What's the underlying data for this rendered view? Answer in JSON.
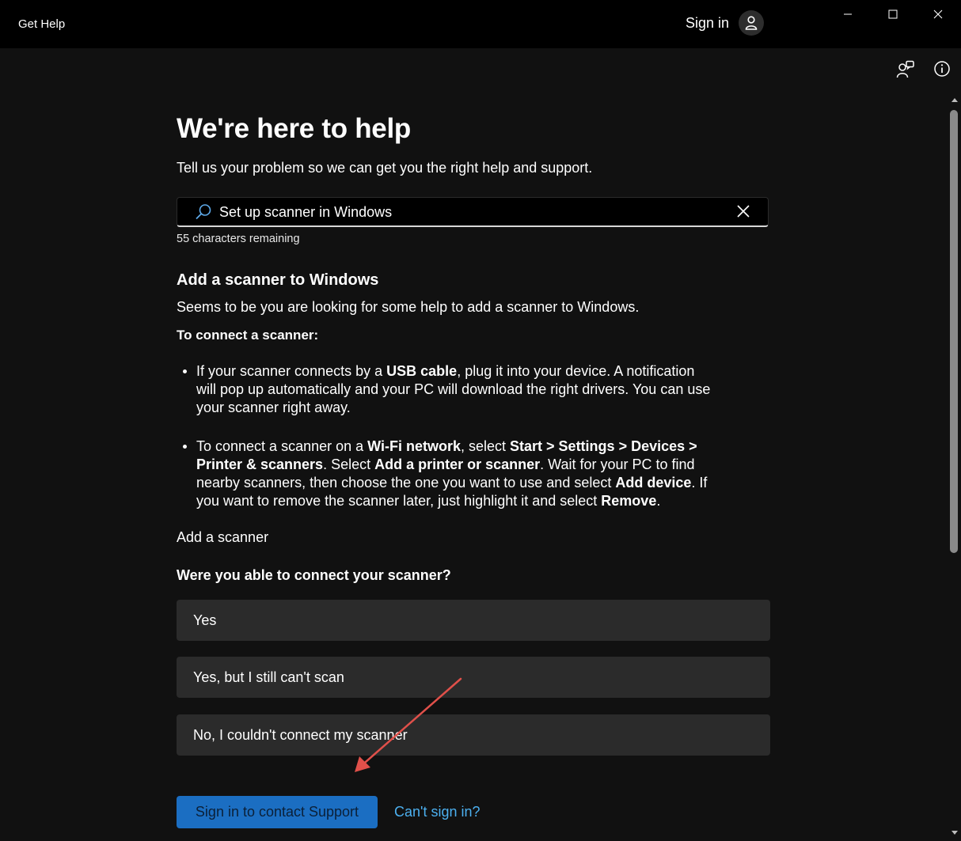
{
  "window": {
    "title": "Get Help",
    "sign_in_label": "Sign in"
  },
  "page": {
    "heading": "We're here to help",
    "subtitle": "Tell us your problem so we can get you the right help and support."
  },
  "search": {
    "value": "Set up scanner in Windows",
    "chars_remaining": "55 characters remaining"
  },
  "article": {
    "title": "Add a scanner to Windows",
    "intro": "Seems to be you are looking for some help to add a scanner to Windows.",
    "connect_heading": "To connect a scanner:",
    "bullet1": {
      "t1": "If your scanner connects by a ",
      "b1": "USB cable",
      "t2": ", plug it into your device. A notification will pop up automatically and your PC will download the right drivers. You can use your scanner right away."
    },
    "bullet2": {
      "t1": "To connect a scanner on a ",
      "b1": "Wi-Fi network",
      "t2": ", select ",
      "b2": "Start",
      "t3": " > ",
      "b3": "Settings",
      "t4": " > ",
      "b4": "Devices",
      "t5": " > ",
      "b5": "Printer & scanners",
      "t6": ". Select ",
      "b6": "Add a printer or scanner",
      "t7": ". Wait for your PC to find nearby scanners, then choose the one you want to use and select ",
      "b7": "Add device",
      "t8": ". If you want to remove the scanner later, just highlight it and select ",
      "b8": "Remove",
      "t9": "."
    },
    "add_scanner_link": "Add a scanner"
  },
  "feedback": {
    "question": "Were you able to connect your scanner?",
    "options": [
      "Yes",
      "Yes, but I still can't scan",
      "No, I couldn't connect my scanner"
    ]
  },
  "actions": {
    "support_button": "Sign in to contact Support",
    "cant_sign_in": "Can't sign in?"
  },
  "icons": {
    "search": "search-icon",
    "clear": "close-icon",
    "avatar": "person-icon",
    "contact": "contact-support-icon",
    "info": "info-icon"
  },
  "colors": {
    "accent": "#1b6ec2",
    "link": "#4cb0f0",
    "annotation_arrow": "#e0504a"
  }
}
